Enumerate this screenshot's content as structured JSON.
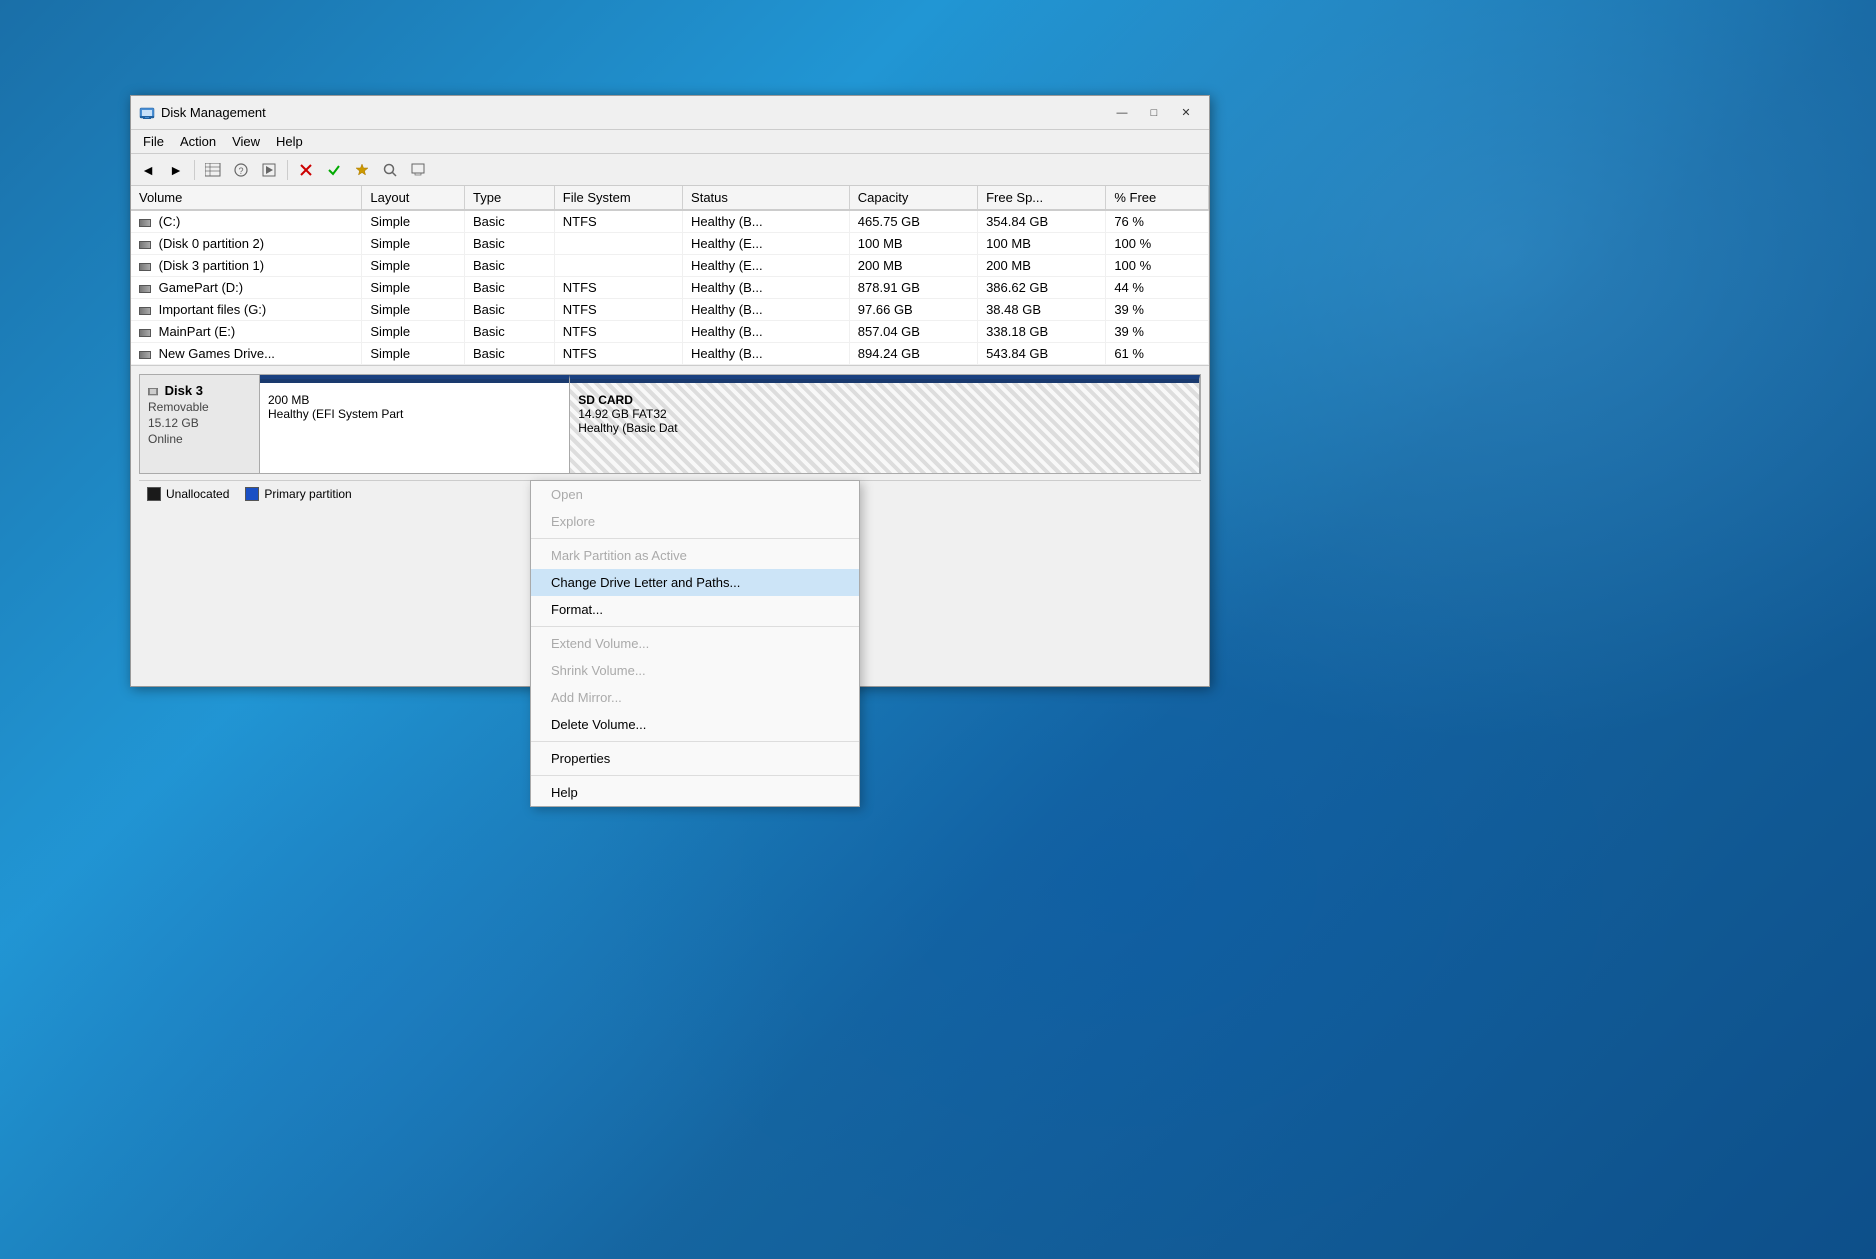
{
  "window": {
    "title": "Disk Management",
    "icon": "💾"
  },
  "menu": {
    "items": [
      "File",
      "Action",
      "View",
      "Help"
    ]
  },
  "toolbar": {
    "buttons": [
      "◀",
      "▶",
      "⊞",
      "?",
      "▷",
      "—",
      "✖",
      "✔",
      "★",
      "🔍",
      "⊡"
    ]
  },
  "table": {
    "columns": [
      "Volume",
      "Layout",
      "Type",
      "File System",
      "Status",
      "Capacity",
      "Free Sp...",
      "% Free"
    ],
    "rows": [
      {
        "icon": "vol",
        "volume": "(C:)",
        "layout": "Simple",
        "type": "Basic",
        "fs": "NTFS",
        "status": "Healthy (B...",
        "capacity": "465.75 GB",
        "free": "354.84 GB",
        "pct": "76 %"
      },
      {
        "icon": "vol",
        "volume": "(Disk 0 partition 2)",
        "layout": "Simple",
        "type": "Basic",
        "fs": "",
        "status": "Healthy (E...",
        "capacity": "100 MB",
        "free": "100 MB",
        "pct": "100 %"
      },
      {
        "icon": "vol",
        "volume": "(Disk 3 partition 1)",
        "layout": "Simple",
        "type": "Basic",
        "fs": "",
        "status": "Healthy (E...",
        "capacity": "200 MB",
        "free": "200 MB",
        "pct": "100 %"
      },
      {
        "icon": "vol",
        "volume": "GamePart (D:)",
        "layout": "Simple",
        "type": "Basic",
        "fs": "NTFS",
        "status": "Healthy (B...",
        "capacity": "878.91 GB",
        "free": "386.62 GB",
        "pct": "44 %"
      },
      {
        "icon": "vol",
        "volume": "Important files (G:)",
        "layout": "Simple",
        "type": "Basic",
        "fs": "NTFS",
        "status": "Healthy (B...",
        "capacity": "97.66 GB",
        "free": "38.48 GB",
        "pct": "39 %"
      },
      {
        "icon": "vol",
        "volume": "MainPart (E:)",
        "layout": "Simple",
        "type": "Basic",
        "fs": "NTFS",
        "status": "Healthy (B...",
        "capacity": "857.04 GB",
        "free": "338.18 GB",
        "pct": "39 %"
      },
      {
        "icon": "vol",
        "volume": "New Games Drive...",
        "layout": "Simple",
        "type": "Basic",
        "fs": "NTFS",
        "status": "Healthy (B...",
        "capacity": "894.24 GB",
        "free": "543.84 GB",
        "pct": "61 %"
      }
    ]
  },
  "disk_map": {
    "disk3": {
      "name": "Disk 3",
      "type": "Removable",
      "size": "15.12 GB",
      "status": "Online",
      "partitions": [
        {
          "name": "",
          "size": "200 MB",
          "fs": "",
          "status": "Healthy (EFI System Part",
          "color": "efi"
        },
        {
          "name": "SD CARD",
          "size": "14.92 GB FAT32",
          "fs": "",
          "status": "Healthy (Basic Dat",
          "color": "sd"
        }
      ]
    }
  },
  "legend": {
    "items": [
      {
        "type": "unallocated",
        "label": "Unallocated"
      },
      {
        "type": "primary",
        "label": "Primary partition"
      }
    ]
  },
  "context_menu": {
    "items": [
      {
        "label": "Open",
        "state": "disabled"
      },
      {
        "label": "Explore",
        "state": "disabled"
      },
      {
        "label": "separator"
      },
      {
        "label": "Mark Partition as Active",
        "state": "disabled"
      },
      {
        "label": "Change Drive Letter and Paths...",
        "state": "active"
      },
      {
        "label": "Format...",
        "state": "normal"
      },
      {
        "label": "separator"
      },
      {
        "label": "Extend Volume...",
        "state": "disabled"
      },
      {
        "label": "Shrink Volume...",
        "state": "disabled"
      },
      {
        "label": "Add Mirror...",
        "state": "disabled"
      },
      {
        "label": "Delete Volume...",
        "state": "normal"
      },
      {
        "label": "separator"
      },
      {
        "label": "Properties",
        "state": "normal"
      },
      {
        "label": "separator"
      },
      {
        "label": "Help",
        "state": "normal"
      }
    ]
  }
}
